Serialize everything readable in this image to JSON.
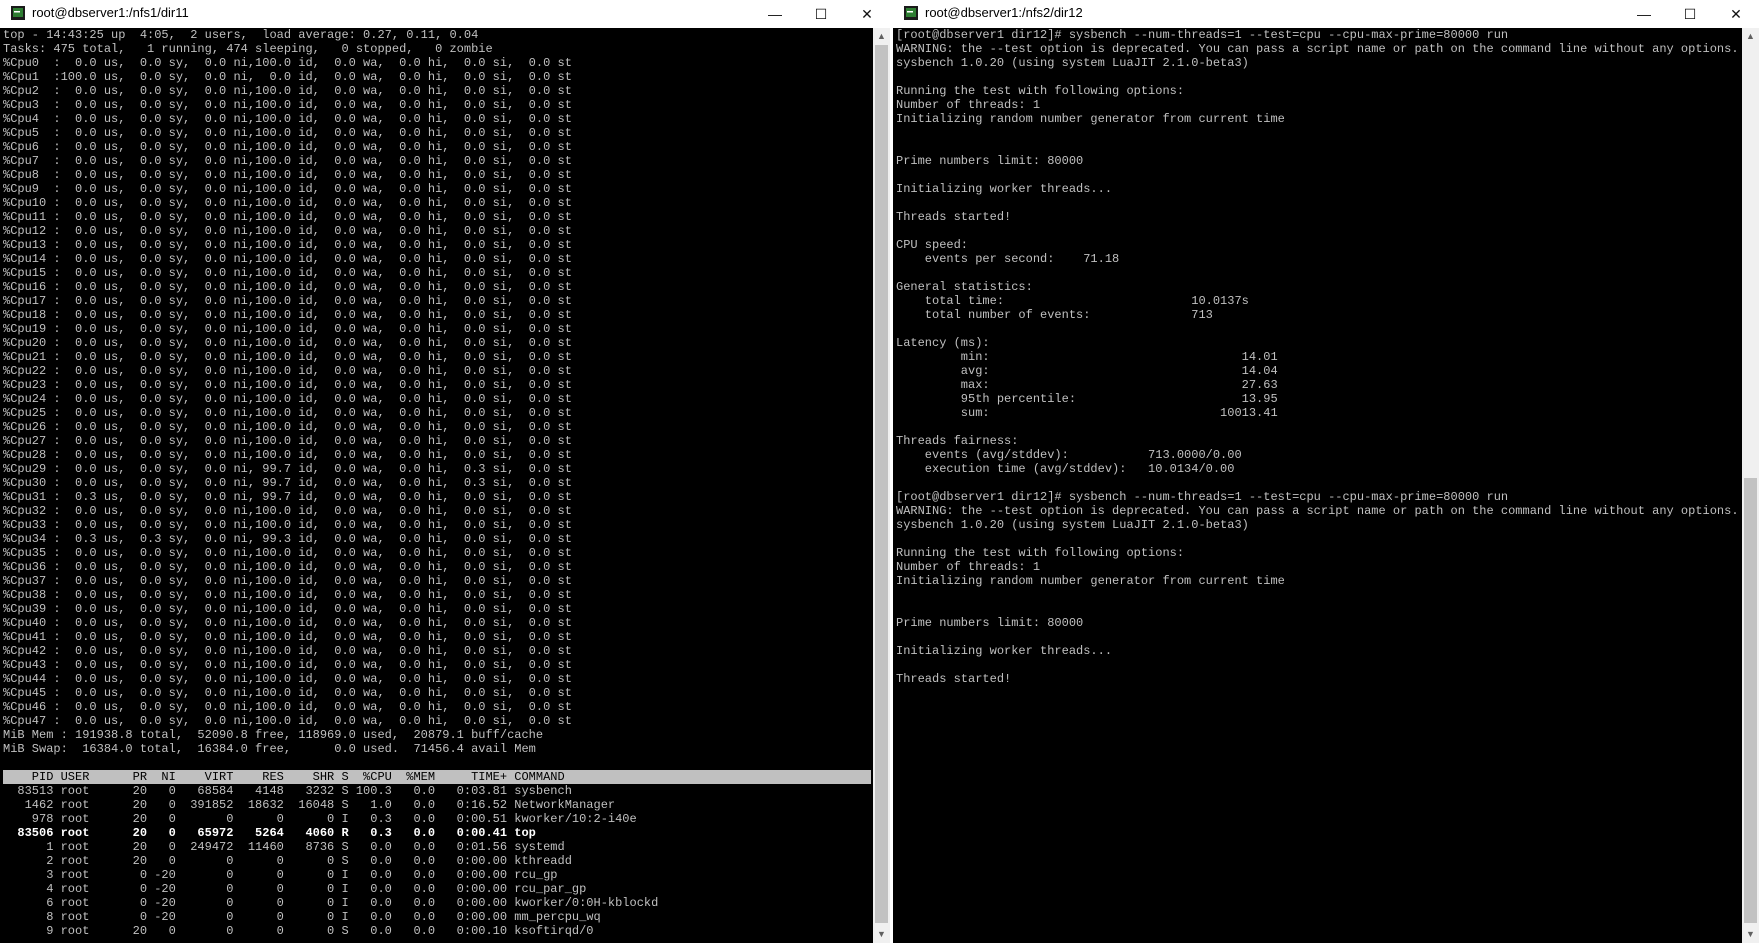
{
  "left_window": {
    "title": "root@dbserver1:/nfs1/dir11",
    "summary": [
      "top - 14:43:25 up  4:05,  2 users,  load average: 0.27, 0.11, 0.04",
      "Tasks: 475 total,   1 running, 474 sleeping,   0 stopped,   0 zombie"
    ],
    "cpu_lines": [
      "%Cpu0  :  0.0 us,  0.0 sy,  0.0 ni,100.0 id,  0.0 wa,  0.0 hi,  0.0 si,  0.0 st",
      "%Cpu1  :100.0 us,  0.0 sy,  0.0 ni,  0.0 id,  0.0 wa,  0.0 hi,  0.0 si,  0.0 st",
      "%Cpu2  :  0.0 us,  0.0 sy,  0.0 ni,100.0 id,  0.0 wa,  0.0 hi,  0.0 si,  0.0 st",
      "%Cpu3  :  0.0 us,  0.0 sy,  0.0 ni,100.0 id,  0.0 wa,  0.0 hi,  0.0 si,  0.0 st",
      "%Cpu4  :  0.0 us,  0.0 sy,  0.0 ni,100.0 id,  0.0 wa,  0.0 hi,  0.0 si,  0.0 st",
      "%Cpu5  :  0.0 us,  0.0 sy,  0.0 ni,100.0 id,  0.0 wa,  0.0 hi,  0.0 si,  0.0 st",
      "%Cpu6  :  0.0 us,  0.0 sy,  0.0 ni,100.0 id,  0.0 wa,  0.0 hi,  0.0 si,  0.0 st",
      "%Cpu7  :  0.0 us,  0.0 sy,  0.0 ni,100.0 id,  0.0 wa,  0.0 hi,  0.0 si,  0.0 st",
      "%Cpu8  :  0.0 us,  0.0 sy,  0.0 ni,100.0 id,  0.0 wa,  0.0 hi,  0.0 si,  0.0 st",
      "%Cpu9  :  0.0 us,  0.0 sy,  0.0 ni,100.0 id,  0.0 wa,  0.0 hi,  0.0 si,  0.0 st",
      "%Cpu10 :  0.0 us,  0.0 sy,  0.0 ni,100.0 id,  0.0 wa,  0.0 hi,  0.0 si,  0.0 st",
      "%Cpu11 :  0.0 us,  0.0 sy,  0.0 ni,100.0 id,  0.0 wa,  0.0 hi,  0.0 si,  0.0 st",
      "%Cpu12 :  0.0 us,  0.0 sy,  0.0 ni,100.0 id,  0.0 wa,  0.0 hi,  0.0 si,  0.0 st",
      "%Cpu13 :  0.0 us,  0.0 sy,  0.0 ni,100.0 id,  0.0 wa,  0.0 hi,  0.0 si,  0.0 st",
      "%Cpu14 :  0.0 us,  0.0 sy,  0.0 ni,100.0 id,  0.0 wa,  0.0 hi,  0.0 si,  0.0 st",
      "%Cpu15 :  0.0 us,  0.0 sy,  0.0 ni,100.0 id,  0.0 wa,  0.0 hi,  0.0 si,  0.0 st",
      "%Cpu16 :  0.0 us,  0.0 sy,  0.0 ni,100.0 id,  0.0 wa,  0.0 hi,  0.0 si,  0.0 st",
      "%Cpu17 :  0.0 us,  0.0 sy,  0.0 ni,100.0 id,  0.0 wa,  0.0 hi,  0.0 si,  0.0 st",
      "%Cpu18 :  0.0 us,  0.0 sy,  0.0 ni,100.0 id,  0.0 wa,  0.0 hi,  0.0 si,  0.0 st",
      "%Cpu19 :  0.0 us,  0.0 sy,  0.0 ni,100.0 id,  0.0 wa,  0.0 hi,  0.0 si,  0.0 st",
      "%Cpu20 :  0.0 us,  0.0 sy,  0.0 ni,100.0 id,  0.0 wa,  0.0 hi,  0.0 si,  0.0 st",
      "%Cpu21 :  0.0 us,  0.0 sy,  0.0 ni,100.0 id,  0.0 wa,  0.0 hi,  0.0 si,  0.0 st",
      "%Cpu22 :  0.0 us,  0.0 sy,  0.0 ni,100.0 id,  0.0 wa,  0.0 hi,  0.0 si,  0.0 st",
      "%Cpu23 :  0.0 us,  0.0 sy,  0.0 ni,100.0 id,  0.0 wa,  0.0 hi,  0.0 si,  0.0 st",
      "%Cpu24 :  0.0 us,  0.0 sy,  0.0 ni,100.0 id,  0.0 wa,  0.0 hi,  0.0 si,  0.0 st",
      "%Cpu25 :  0.0 us,  0.0 sy,  0.0 ni,100.0 id,  0.0 wa,  0.0 hi,  0.0 si,  0.0 st",
      "%Cpu26 :  0.0 us,  0.0 sy,  0.0 ni,100.0 id,  0.0 wa,  0.0 hi,  0.0 si,  0.0 st",
      "%Cpu27 :  0.0 us,  0.0 sy,  0.0 ni,100.0 id,  0.0 wa,  0.0 hi,  0.0 si,  0.0 st",
      "%Cpu28 :  0.0 us,  0.0 sy,  0.0 ni,100.0 id,  0.0 wa,  0.0 hi,  0.0 si,  0.0 st",
      "%Cpu29 :  0.0 us,  0.0 sy,  0.0 ni, 99.7 id,  0.0 wa,  0.0 hi,  0.3 si,  0.0 st",
      "%Cpu30 :  0.0 us,  0.0 sy,  0.0 ni, 99.7 id,  0.0 wa,  0.0 hi,  0.3 si,  0.0 st",
      "%Cpu31 :  0.3 us,  0.0 sy,  0.0 ni, 99.7 id,  0.0 wa,  0.0 hi,  0.0 si,  0.0 st",
      "%Cpu32 :  0.0 us,  0.0 sy,  0.0 ni,100.0 id,  0.0 wa,  0.0 hi,  0.0 si,  0.0 st",
      "%Cpu33 :  0.0 us,  0.0 sy,  0.0 ni,100.0 id,  0.0 wa,  0.0 hi,  0.0 si,  0.0 st",
      "%Cpu34 :  0.3 us,  0.3 sy,  0.0 ni, 99.3 id,  0.0 wa,  0.0 hi,  0.0 si,  0.0 st",
      "%Cpu35 :  0.0 us,  0.0 sy,  0.0 ni,100.0 id,  0.0 wa,  0.0 hi,  0.0 si,  0.0 st",
      "%Cpu36 :  0.0 us,  0.0 sy,  0.0 ni,100.0 id,  0.0 wa,  0.0 hi,  0.0 si,  0.0 st",
      "%Cpu37 :  0.0 us,  0.0 sy,  0.0 ni,100.0 id,  0.0 wa,  0.0 hi,  0.0 si,  0.0 st",
      "%Cpu38 :  0.0 us,  0.0 sy,  0.0 ni,100.0 id,  0.0 wa,  0.0 hi,  0.0 si,  0.0 st",
      "%Cpu39 :  0.0 us,  0.0 sy,  0.0 ni,100.0 id,  0.0 wa,  0.0 hi,  0.0 si,  0.0 st",
      "%Cpu40 :  0.0 us,  0.0 sy,  0.0 ni,100.0 id,  0.0 wa,  0.0 hi,  0.0 si,  0.0 st",
      "%Cpu41 :  0.0 us,  0.0 sy,  0.0 ni,100.0 id,  0.0 wa,  0.0 hi,  0.0 si,  0.0 st",
      "%Cpu42 :  0.0 us,  0.0 sy,  0.0 ni,100.0 id,  0.0 wa,  0.0 hi,  0.0 si,  0.0 st",
      "%Cpu43 :  0.0 us,  0.0 sy,  0.0 ni,100.0 id,  0.0 wa,  0.0 hi,  0.0 si,  0.0 st",
      "%Cpu44 :  0.0 us,  0.0 sy,  0.0 ni,100.0 id,  0.0 wa,  0.0 hi,  0.0 si,  0.0 st",
      "%Cpu45 :  0.0 us,  0.0 sy,  0.0 ni,100.0 id,  0.0 wa,  0.0 hi,  0.0 si,  0.0 st",
      "%Cpu46 :  0.0 us,  0.0 sy,  0.0 ni,100.0 id,  0.0 wa,  0.0 hi,  0.0 si,  0.0 st",
      "%Cpu47 :  0.0 us,  0.0 sy,  0.0 ni,100.0 id,  0.0 wa,  0.0 hi,  0.0 si,  0.0 st"
    ],
    "mem_lines": [
      "MiB Mem : 191938.8 total,  52090.8 free, 118969.0 used,  20879.1 buff/cache",
      "MiB Swap:  16384.0 total,  16384.0 free,      0.0 used.  71456.4 avail Mem"
    ],
    "proc_header": "    PID USER      PR  NI    VIRT    RES    SHR S  %CPU  %MEM     TIME+ COMMAND",
    "processes": [
      "  83513 root      20   0   68584   4148   3232 S 100.3   0.0   0:03.81 sysbench",
      "   1462 root      20   0  391852  18632  16048 S   1.0   0.0   0:16.52 NetworkManager",
      "    978 root      20   0       0      0      0 I   0.3   0.0   0:00.51 kworker/10:2-i40e",
      "  83506 root      20   0   65972   5264   4060 R   0.3   0.0   0:00.41 top",
      "      1 root      20   0  249472  11460   8736 S   0.0   0.0   0:01.56 systemd",
      "      2 root      20   0       0      0      0 S   0.0   0.0   0:00.00 kthreadd",
      "      3 root       0 -20       0      0      0 I   0.0   0.0   0:00.00 rcu_gp",
      "      4 root       0 -20       0      0      0 I   0.0   0.0   0:00.00 rcu_par_gp",
      "      6 root       0 -20       0      0      0 I   0.0   0.0   0:00.00 kworker/0:0H-kblockd",
      "      8 root       0 -20       0      0      0 I   0.0   0.0   0:00.00 mm_percpu_wq",
      "      9 root      20   0       0      0      0 S   0.0   0.0   0:00.10 ksoftirqd/0"
    ],
    "bold_process_index": 3
  },
  "right_window": {
    "title": "root@dbserver1:/nfs2/dir12",
    "lines": [
      "[root@dbserver1 dir12]# sysbench --num-threads=1 --test=cpu --cpu-max-prime=80000 run",
      "WARNING: the --test option is deprecated. You can pass a script name or path on the command line without any options.",
      "sysbench 1.0.20 (using system LuaJIT 2.1.0-beta3)",
      "",
      "Running the test with following options:",
      "Number of threads: 1",
      "Initializing random number generator from current time",
      "",
      "",
      "Prime numbers limit: 80000",
      "",
      "Initializing worker threads...",
      "",
      "Threads started!",
      "",
      "CPU speed:",
      "    events per second:    71.18",
      "",
      "General statistics:",
      "    total time:                          10.0137s",
      "    total number of events:              713",
      "",
      "Latency (ms):",
      "         min:                                   14.01",
      "         avg:                                   14.04",
      "         max:                                   27.63",
      "         95th percentile:                       13.95",
      "         sum:                                10013.41",
      "",
      "Threads fairness:",
      "    events (avg/stddev):           713.0000/0.00",
      "    execution time (avg/stddev):   10.0134/0.00",
      "",
      "[root@dbserver1 dir12]# sysbench --num-threads=1 --test=cpu --cpu-max-prime=80000 run",
      "WARNING: the --test option is deprecated. You can pass a script name or path on the command line without any options.",
      "sysbench 1.0.20 (using system LuaJIT 2.1.0-beta3)",
      "",
      "Running the test with following options:",
      "Number of threads: 1",
      "Initializing random number generator from current time",
      "",
      "",
      "Prime numbers limit: 80000",
      "",
      "Initializing worker threads...",
      "",
      "Threads started!"
    ]
  },
  "window_buttons": {
    "minimize": "—",
    "maximize": "☐",
    "close": "✕"
  },
  "colors": {
    "terminal_bg": "#000000",
    "terminal_fg": "#c0c0c0",
    "bold_fg": "#ffffff",
    "header_bg": "#c0c0c0"
  }
}
